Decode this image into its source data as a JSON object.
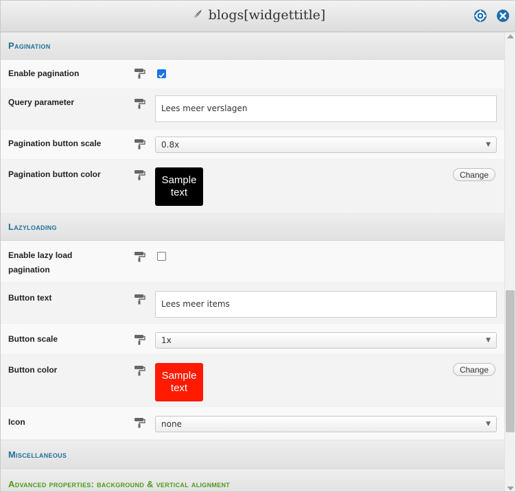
{
  "window": {
    "title": "blogs[widgettitle]"
  },
  "sections": {
    "pagination": "Pagination",
    "lazyloading": "Lazyloading",
    "miscellaneous": "Miscellaneous",
    "advanced": "Advanced properties: background & vertical alignment"
  },
  "pagination": {
    "enable_label": "Enable pagination",
    "enable_checked": true,
    "query_label": "Query parameter",
    "query_value": "Lees meer verslagen",
    "scale_label": "Pagination button scale",
    "scale_value": "0.8x",
    "color_label": "Pagination button color",
    "color_sample": "Sample text",
    "color_hex": "#000000",
    "change_label": "Change"
  },
  "lazy": {
    "enable_label": "Enable lazy load pagination",
    "enable_checked": false,
    "button_text_label": "Button text",
    "button_text_value": "Lees meer items",
    "scale_label": "Button scale",
    "scale_value": "1x",
    "color_label": "Button color",
    "color_sample": "Sample text",
    "color_hex": "#ff1a00",
    "change_label": "Change",
    "icon_label": "Icon",
    "icon_value": "none"
  },
  "colors": {
    "section_title": "#1f6f9c",
    "advanced_title": "#4f9a1b",
    "titlebar_button": "#1e6fae",
    "checkbox_checked": "#1a73e8"
  },
  "icons": {
    "title_icon": "feather-pen-icon",
    "settings_button": "settings-icon",
    "close_button": "close-icon",
    "row_style_icon": "paint-roller-icon",
    "select_caret": "caret-down-icon"
  }
}
